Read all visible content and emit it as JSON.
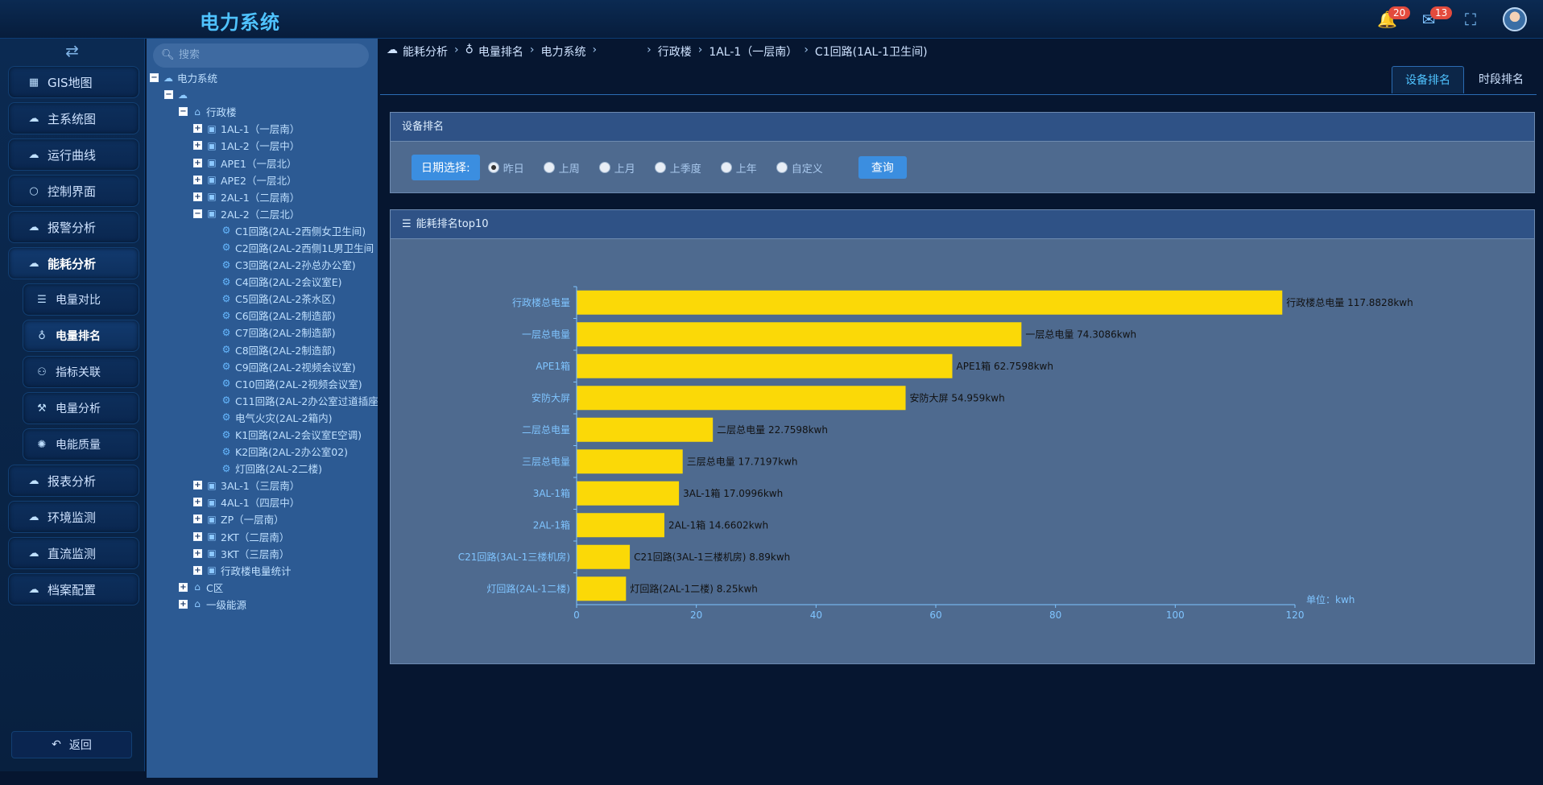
{
  "app": {
    "title": "电力系统",
    "notifications": "20",
    "messages": "13",
    "bell_icon": "bell-icon",
    "mail_icon": "mail-icon",
    "fullscreen_icon": "fullscreen-icon"
  },
  "sidebar": {
    "toggle_icon": "swap-icon",
    "items": [
      {
        "label": "GIS地图",
        "icon": "grid-icon"
      },
      {
        "label": "主系统图",
        "icon": "cloud-icon"
      },
      {
        "label": "运行曲线",
        "icon": "cloud-icon"
      },
      {
        "label": "控制界面",
        "icon": "circle-icon"
      },
      {
        "label": "报警分析",
        "icon": "cloud-icon"
      },
      {
        "label": "能耗分析",
        "icon": "cloud-icon",
        "active": true
      },
      {
        "label": "电量对比",
        "icon": "list-icon",
        "sub": true
      },
      {
        "label": "电量排名",
        "icon": "pin-icon",
        "sub": true,
        "active": true
      },
      {
        "label": "指标关联",
        "icon": "sitemap-icon",
        "sub": true
      },
      {
        "label": "电量分析",
        "icon": "magic-icon",
        "sub": true
      },
      {
        "label": "电能质量",
        "icon": "gear-icon",
        "sub": true
      },
      {
        "label": "报表分析",
        "icon": "cloud-icon"
      },
      {
        "label": "环境监测",
        "icon": "cloud-icon"
      },
      {
        "label": "直流监测",
        "icon": "cloud-icon"
      },
      {
        "label": "档案配置",
        "icon": "cloud-icon"
      }
    ],
    "back_label": "返回"
  },
  "tree": {
    "search_placeholder": "搜索",
    "nodes": [
      {
        "label": "电力系统",
        "level": 0,
        "exp": "−",
        "icon": "cloud"
      },
      {
        "label": "",
        "level": 1,
        "exp": "−",
        "icon": "cloud"
      },
      {
        "label": "行政楼",
        "level": 2,
        "exp": "−",
        "icon": "home"
      },
      {
        "label": "1AL-1（一层南）",
        "level": 3,
        "exp": "+",
        "icon": "box"
      },
      {
        "label": "1AL-2（一层中）",
        "level": 3,
        "exp": "+",
        "icon": "box"
      },
      {
        "label": "APE1（一层北）",
        "level": 3,
        "exp": "+",
        "icon": "box"
      },
      {
        "label": "APE2（一层北）",
        "level": 3,
        "exp": "+",
        "icon": "box"
      },
      {
        "label": "2AL-1（二层南）",
        "level": 3,
        "exp": "+",
        "icon": "box"
      },
      {
        "label": "2AL-2（二层北）",
        "level": 3,
        "exp": "−",
        "icon": "box"
      },
      {
        "label": "C1回路(2AL-2西侧女卫生间)",
        "level": 4,
        "exp": "",
        "icon": "chip"
      },
      {
        "label": "C2回路(2AL-2西侧1L男卫生间",
        "level": 4,
        "exp": "",
        "icon": "chip"
      },
      {
        "label": "C3回路(2AL-2孙总办公室)",
        "level": 4,
        "exp": "",
        "icon": "chip"
      },
      {
        "label": "C4回路(2AL-2会议室E)",
        "level": 4,
        "exp": "",
        "icon": "chip"
      },
      {
        "label": "C5回路(2AL-2茶水区)",
        "level": 4,
        "exp": "",
        "icon": "chip"
      },
      {
        "label": "C6回路(2AL-2制造部)",
        "level": 4,
        "exp": "",
        "icon": "chip"
      },
      {
        "label": "C7回路(2AL-2制造部)",
        "level": 4,
        "exp": "",
        "icon": "chip"
      },
      {
        "label": "C8回路(2AL-2制造部)",
        "level": 4,
        "exp": "",
        "icon": "chip"
      },
      {
        "label": "C9回路(2AL-2视频会议室)",
        "level": 4,
        "exp": "",
        "icon": "chip"
      },
      {
        "label": "C10回路(2AL-2视频会议室)",
        "level": 4,
        "exp": "",
        "icon": "chip"
      },
      {
        "label": "C11回路(2AL-2办公室过道插座",
        "level": 4,
        "exp": "",
        "icon": "chip"
      },
      {
        "label": "电气火灾(2AL-2箱内)",
        "level": 4,
        "exp": "",
        "icon": "chip"
      },
      {
        "label": "K1回路(2AL-2会议室E空调)",
        "level": 4,
        "exp": "",
        "icon": "chip"
      },
      {
        "label": "K2回路(2AL-2办公室02)",
        "level": 4,
        "exp": "",
        "icon": "chip"
      },
      {
        "label": "灯回路(2AL-2二楼)",
        "level": 4,
        "exp": "",
        "icon": "chip"
      },
      {
        "label": "3AL-1（三层南）",
        "level": 3,
        "exp": "+",
        "icon": "box"
      },
      {
        "label": "4AL-1（四层中）",
        "level": 3,
        "exp": "+",
        "icon": "box"
      },
      {
        "label": "ZP（一层南）",
        "level": 3,
        "exp": "+",
        "icon": "box"
      },
      {
        "label": "2KT（二层南）",
        "level": 3,
        "exp": "+",
        "icon": "box"
      },
      {
        "label": "3KT（三层南）",
        "level": 3,
        "exp": "+",
        "icon": "box"
      },
      {
        "label": "行政楼电量统计",
        "level": 3,
        "exp": "+",
        "icon": "box"
      },
      {
        "label": "C区",
        "level": 2,
        "exp": "+",
        "icon": "home"
      },
      {
        "label": "一级能源",
        "level": 2,
        "exp": "+",
        "icon": "home"
      }
    ]
  },
  "breadcrumb": [
    "能耗分析",
    "电量排名",
    "电力系统",
    "",
    "行政楼",
    "1AL-1（一层南）",
    "C1回路(1AL-1卫生间)"
  ],
  "tabs": [
    "设备排名",
    "时段排名"
  ],
  "filter_panel": {
    "title": "设备排名",
    "date_label": "日期选择:",
    "options": [
      "昨日",
      "上周",
      "上月",
      "上季度",
      "上年",
      "自定义"
    ],
    "selected": "昨日",
    "query_label": "查询"
  },
  "chart_panel": {
    "title": "能耗排名top10"
  },
  "chart_data": {
    "type": "bar",
    "orientation": "horizontal",
    "title": "",
    "xlim": [
      0,
      120
    ],
    "xticks": [
      0,
      20,
      40,
      60,
      80,
      100,
      120
    ],
    "unit_label": "单位：kwh",
    "categories": [
      "行政楼总电量",
      "一层总电量",
      "APE1箱",
      "安防大屏",
      "二层总电量",
      "三层总电量",
      "3AL-1箱",
      "2AL-1箱",
      "C21回路(3AL-1三楼机房)",
      "灯回路(2AL-1二楼)"
    ],
    "values": [
      117.8828,
      74.3086,
      62.7598,
      54.959,
      22.7598,
      17.7197,
      17.0996,
      14.6602,
      8.89,
      8.25
    ],
    "value_labels": [
      "行政楼总电量 117.8828kwh",
      "一层总电量 74.3086kwh",
      "APE1箱 62.7598kwh",
      "安防大屏 54.959kwh",
      "二层总电量 22.7598kwh",
      "三层总电量 17.7197kwh",
      "3AL-1箱 17.0996kwh",
      "2AL-1箱 14.6602kwh",
      "C21回路(3AL-1三楼机房) 8.89kwh",
      "灯回路(2AL-1二楼) 8.25kwh"
    ],
    "bar_color": "#fbd907"
  }
}
